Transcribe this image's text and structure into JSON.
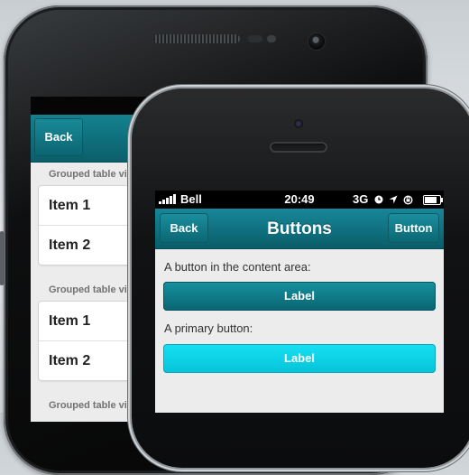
{
  "android": {
    "back_label": "Back",
    "groups": [
      {
        "header": "Grouped table view",
        "items": [
          "Item 1",
          "Item 2"
        ]
      },
      {
        "header": "Grouped table view",
        "items": [
          "Item 1",
          "Item 2"
        ]
      },
      {
        "header": "Grouped table view",
        "items": []
      }
    ]
  },
  "iphone": {
    "status": {
      "carrier": "Bell",
      "time": "20:49",
      "network": "3G"
    },
    "navbar": {
      "title": "Buttons",
      "back_label": "Back",
      "right_label": "Button"
    },
    "content": {
      "label_1": "A button in the content area:",
      "button_1": "Label",
      "label_2": "A primary button:",
      "button_2": "Label"
    }
  },
  "colors": {
    "navbar": "#0f7583",
    "primary_button": "#0fd3e8",
    "content_bg": "#ececec"
  }
}
